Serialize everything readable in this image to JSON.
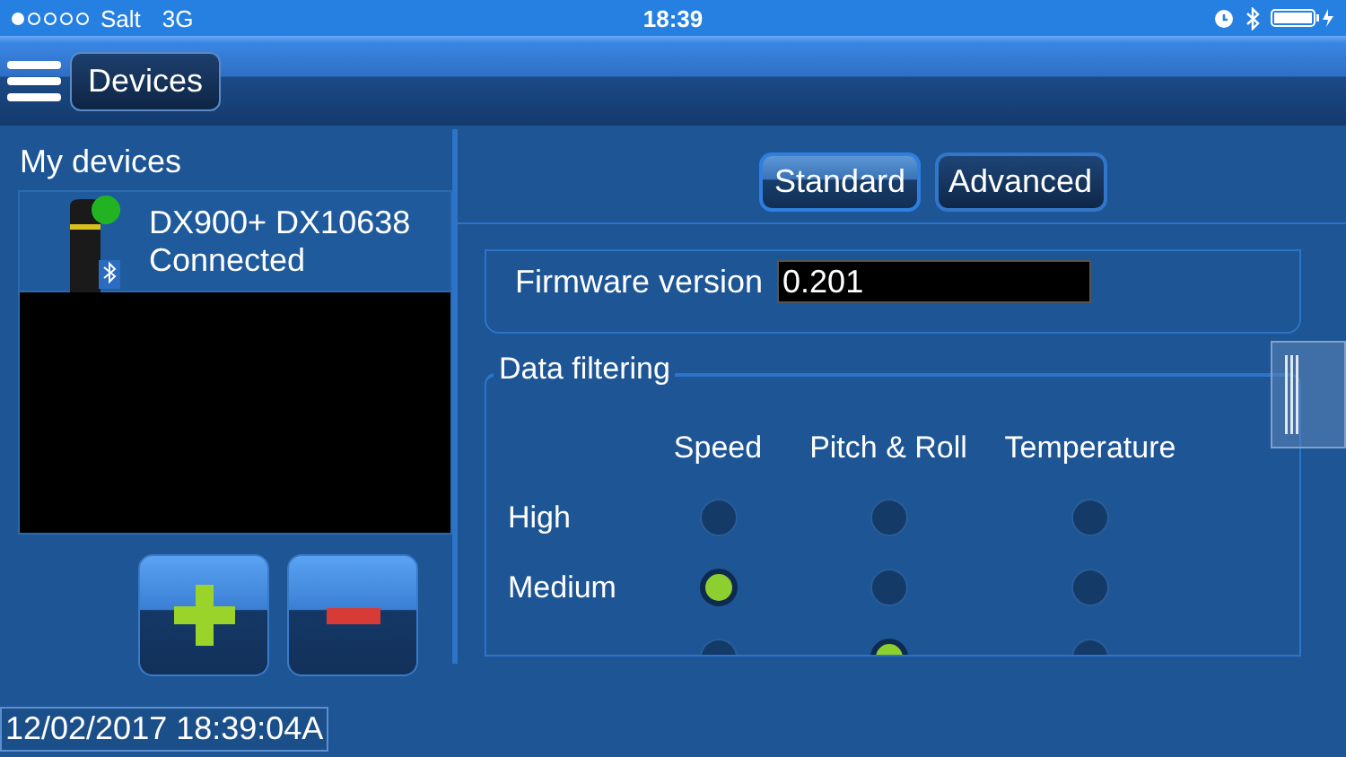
{
  "status_bar": {
    "carrier": "Salt",
    "network": "3G",
    "time": "18:39"
  },
  "nav": {
    "title": "Devices"
  },
  "devices_panel": {
    "title": "My devices",
    "devices": [
      {
        "name": "DX900+ DX10638",
        "status": "Connected",
        "connected": true,
        "selected": true
      }
    ],
    "timestamp": "12/02/2017 18:39:04A"
  },
  "tabs": [
    {
      "label": "Standard",
      "selected": true
    },
    {
      "label": "Advanced",
      "selected": false
    }
  ],
  "firmware": {
    "label": "Firmware version",
    "value": "0.201"
  },
  "data_filtering": {
    "title": "Data filtering",
    "columns": [
      "Speed",
      "Pitch & Roll",
      "Temperature"
    ],
    "rows": [
      {
        "label": "High",
        "options": [
          {
            "selected": false
          },
          {
            "selected": false
          },
          {
            "selected": false
          }
        ]
      },
      {
        "label": "Medium",
        "options": [
          {
            "selected": true
          },
          {
            "selected": false
          },
          {
            "selected": false
          }
        ]
      },
      {
        "options": [
          {
            "selected": false
          },
          {
            "selected": true
          },
          {
            "selected": false
          }
        ]
      }
    ]
  }
}
